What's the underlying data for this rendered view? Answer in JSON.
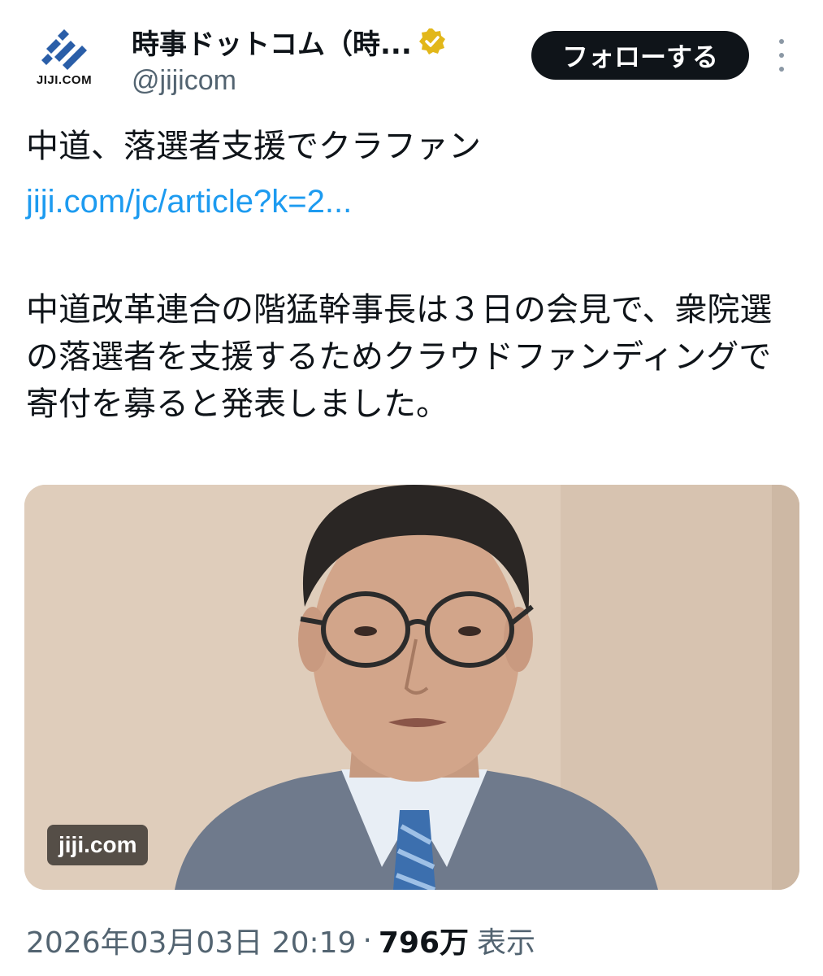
{
  "header": {
    "avatar_text": "JIJI.COM",
    "display_name": "時事ドットコム（時...",
    "handle": "@jijicom",
    "follow_label": "フォローする",
    "verified_icon": "verified-badge-icon",
    "more_icon": "more-vertical-icon"
  },
  "tweet": {
    "headline": "中道、落選者支援でクラファン",
    "link": "jiji.com/jc/article?k=2...",
    "body": "中道改革連合の階猛幹事長は３日の会見で、衆院選の落選者を支援するためクラウドファンディングで寄付を募ると発表しました。"
  },
  "media": {
    "watermark": "jiji.com"
  },
  "meta": {
    "timestamp": "2026年03月03日 20:19",
    "separator": "·",
    "views_count": "796万",
    "views_label": "表示"
  },
  "colors": {
    "link": "#1d9bf0",
    "verified_gold": "#e2b719",
    "follow_bg": "#0f1419",
    "secondary_text": "#536471"
  }
}
